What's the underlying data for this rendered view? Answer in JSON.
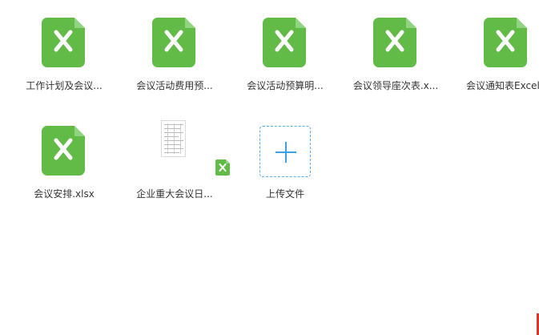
{
  "files": [
    {
      "name": "工作计划及会议...",
      "icon": "excel-file-icon"
    },
    {
      "name": "会议活动费用预...",
      "icon": "excel-file-icon"
    },
    {
      "name": "会议活动预算明...",
      "icon": "excel-file-icon"
    },
    {
      "name": "会议领导座次表.x...",
      "icon": "excel-file-icon"
    },
    {
      "name": "会议通知表Excel",
      "icon": "excel-file-icon"
    },
    {
      "name": "会议安排.xlsx",
      "icon": "excel-file-icon"
    },
    {
      "name": "企业重大会议日...",
      "icon": "spreadsheet-thumbnail"
    }
  ],
  "upload": {
    "label": "上传文件",
    "icon": "plus-icon"
  },
  "colors": {
    "excel_green": "#62bb47",
    "excel_green_fold": "#8fd57f",
    "upload_blue": "#3aa1e6",
    "accent_red": "#d43a2c"
  }
}
